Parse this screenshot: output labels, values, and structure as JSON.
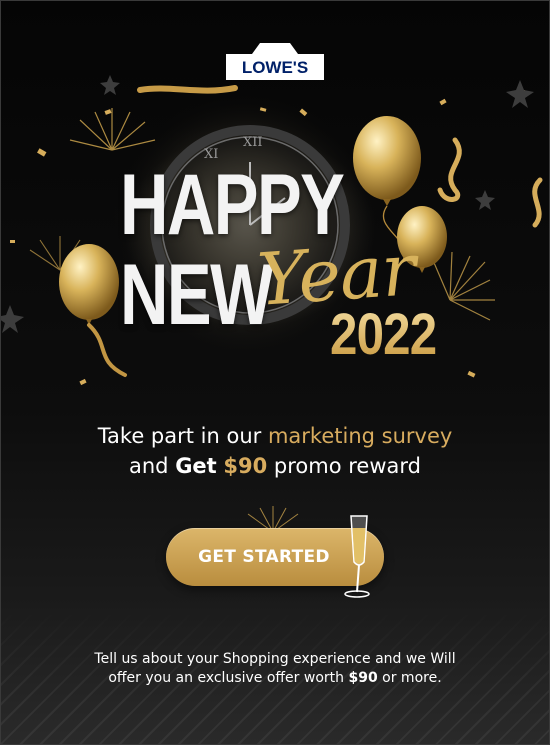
{
  "brand": {
    "logo_text": "LOWE'S"
  },
  "hero": {
    "line1": "HAPPY",
    "line2": "NEW",
    "script_word": "Year",
    "year": "2022",
    "clock_numerals": [
      "XI",
      "XII"
    ]
  },
  "headline": {
    "part1": "Take part in our ",
    "highlight": "marketing survey",
    "part2": "and ",
    "get": "Get",
    "space": " ",
    "amount": "$90",
    "part3": " promo reward"
  },
  "cta": {
    "label": "GET STARTED"
  },
  "footer": {
    "line1": "Tell us about your Shopping experience and we Will",
    "line2_prefix": "offer you an exclusive offer worth ",
    "amount": "$90",
    "line2_suffix": " or more."
  },
  "colors": {
    "gold": "#d8ac5f",
    "background": "#0b0b0b",
    "text": "#ffffff",
    "logo_blue": "#012169"
  },
  "icons": {
    "logo": "lowes-house-logo",
    "balloon": "gold-balloon-icon",
    "champagne": "champagne-glass-icon",
    "firework": "firework-icon"
  }
}
